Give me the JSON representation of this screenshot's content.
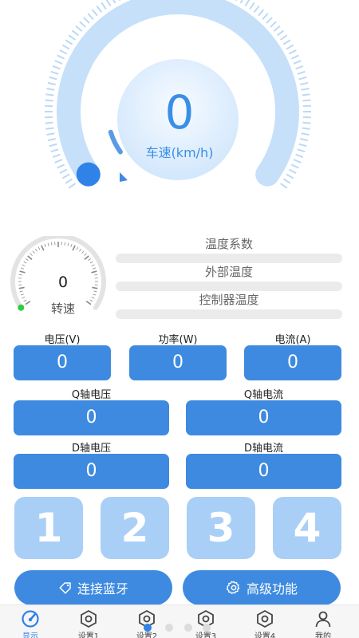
{
  "speedometer": {
    "value": "0",
    "unit_label": "车速(km/h)",
    "max_fraction": 0
  },
  "rpm": {
    "value": "0",
    "label": "转速"
  },
  "temperatures": [
    {
      "label": "温度系数",
      "level": 0
    },
    {
      "label": "外部温度",
      "level": 0
    },
    {
      "label": "控制器温度",
      "level": 0
    }
  ],
  "metrics": {
    "voltage": {
      "label": "电压(V)",
      "value": "0"
    },
    "power": {
      "label": "功率(W)",
      "value": "0"
    },
    "current": {
      "label": "电流(A)",
      "value": "0"
    },
    "q_voltage": {
      "label": "Q轴电压",
      "value": "0"
    },
    "q_current": {
      "label": "Q轴电流",
      "value": "0"
    },
    "d_voltage": {
      "label": "D轴电压",
      "value": "0"
    },
    "d_current": {
      "label": "D轴电流",
      "value": "0"
    }
  },
  "mode_buttons": [
    "1",
    "2",
    "3",
    "4"
  ],
  "actions": {
    "bluetooth": "连接蓝牙",
    "advanced": "高级功能"
  },
  "nav": [
    {
      "label": "显示",
      "icon": "dashboard-icon",
      "active": true
    },
    {
      "label": "设置1",
      "icon": "hexagon-nut-icon",
      "active": false
    },
    {
      "label": "设置2",
      "icon": "hexagon-nut-icon",
      "active": false
    },
    {
      "label": "设置3",
      "icon": "hexagon-nut-icon",
      "active": false
    },
    {
      "label": "设置4",
      "icon": "hexagon-nut-icon",
      "active": false
    },
    {
      "label": "我的",
      "icon": "user-icon",
      "active": false
    }
  ],
  "colors": {
    "primary": "#3e8ae0",
    "gauge_light": "#c6e0fa",
    "button_light": "#a9cff7",
    "active_nav": "#2f82e8"
  }
}
